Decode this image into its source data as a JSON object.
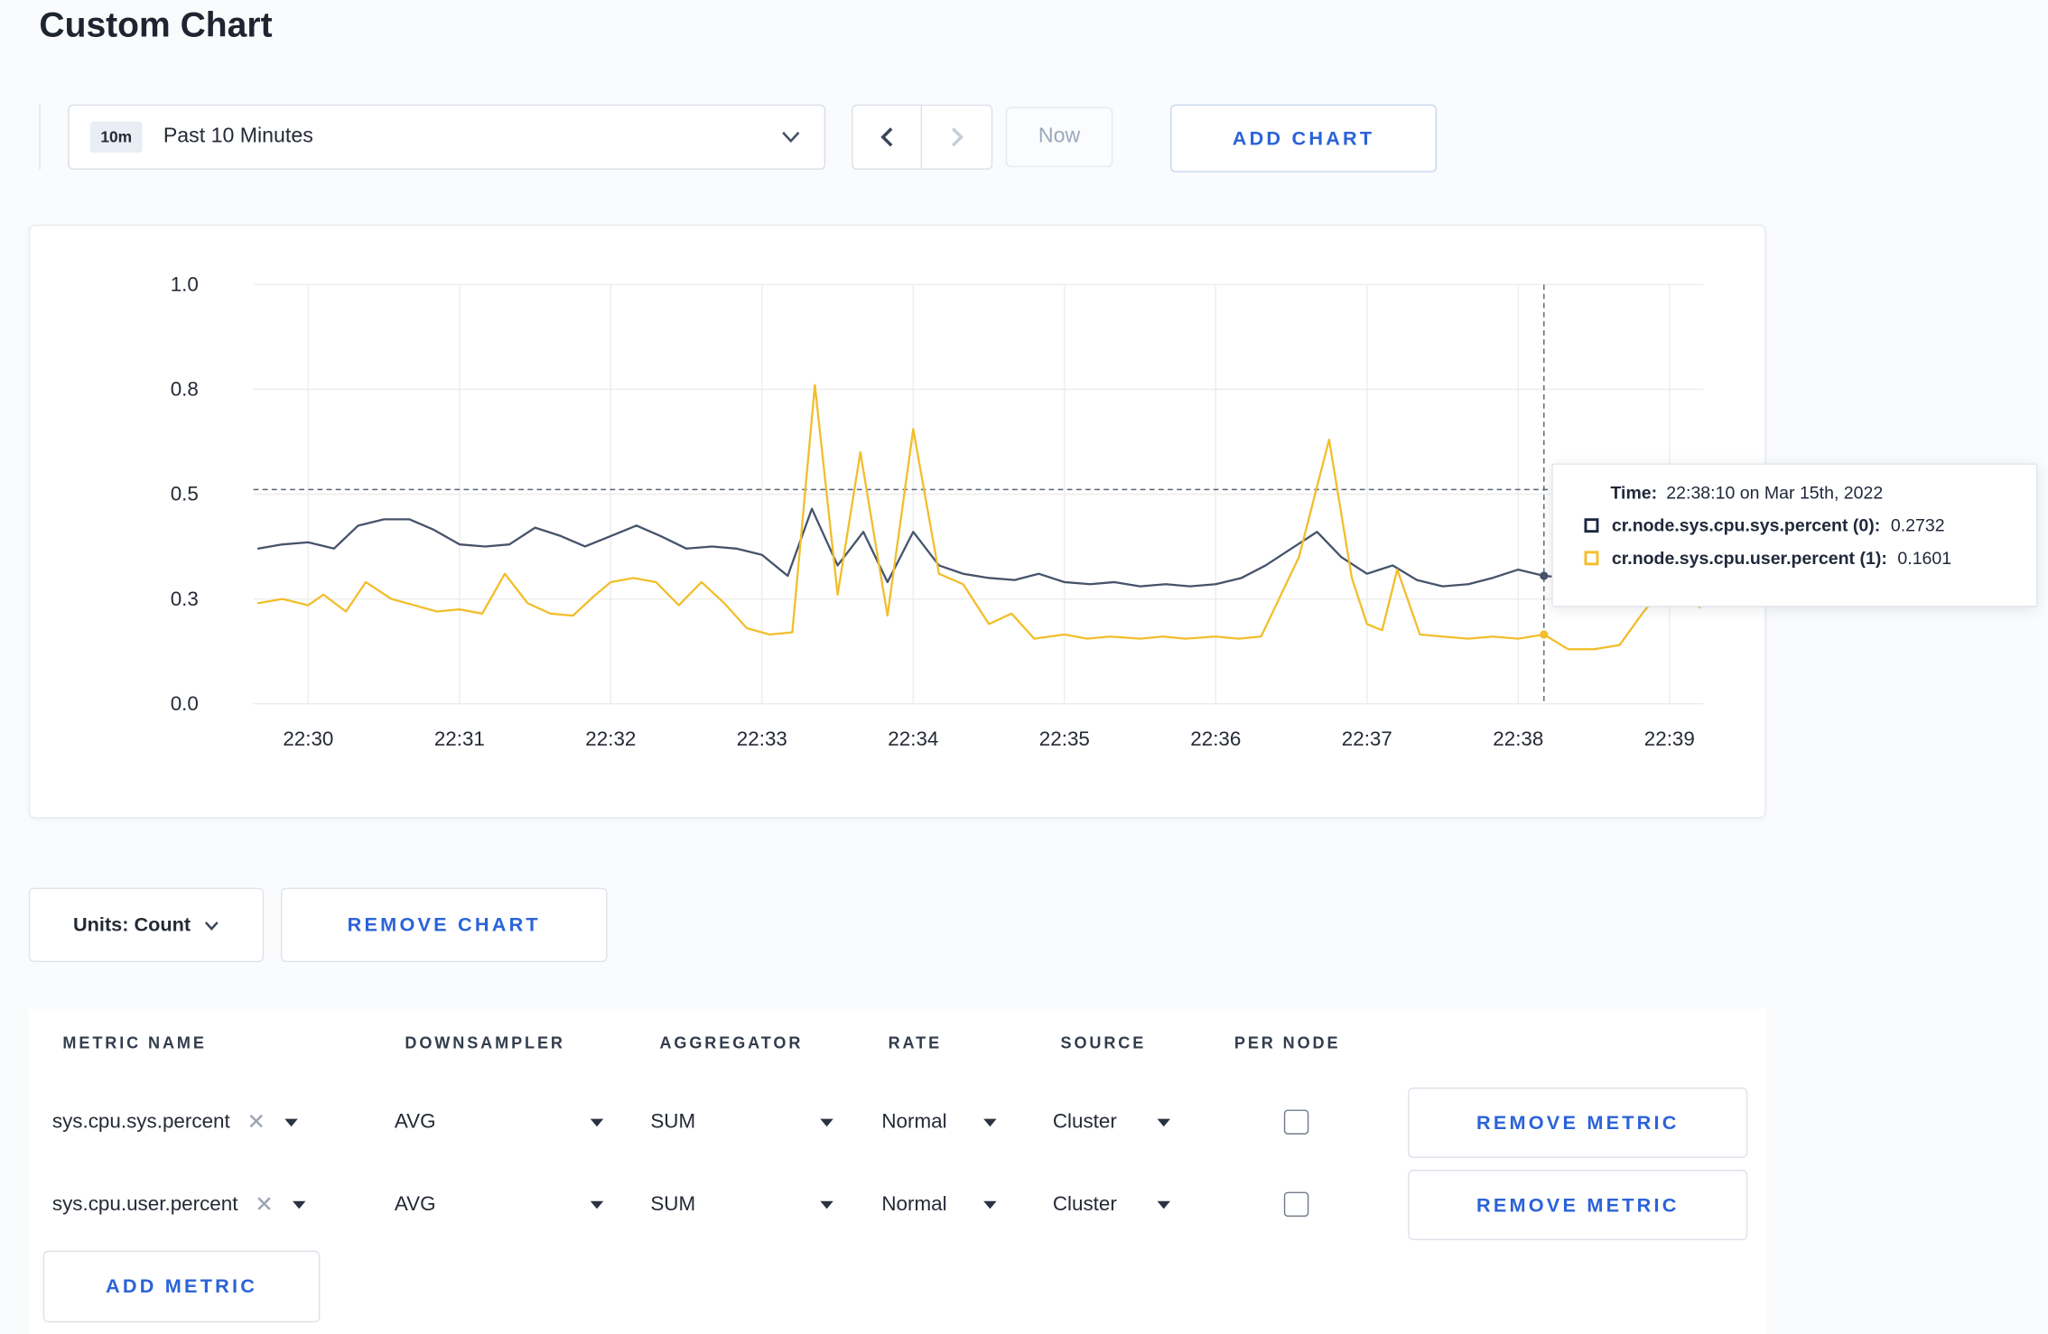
{
  "page": {
    "title": "Custom Chart"
  },
  "colors": {
    "accent_blue": "#2b63d8",
    "series_sys": "#46536b",
    "series_user": "#f2be2c",
    "grid": "#ededee",
    "crosshair": "#5b6573"
  },
  "icons": {
    "time_dropdown": "chevron-down",
    "prev": "chevron-left",
    "next": "chevron-right",
    "units_dropdown": "chevron-down",
    "select_caret": "caret-down",
    "metric_remove": "x-mark",
    "series_swatch": "square-outline"
  },
  "toolbar": {
    "time_range": {
      "badge": "10m",
      "label": "Past 10 Minutes"
    },
    "now_label": "Now",
    "add_chart_label": "ADD CHART"
  },
  "tooltip": {
    "time_label": "Time:",
    "time_value": "22:38:10 on Mar 15th, 2022",
    "rows": [
      {
        "label": "cr.node.sys.cpu.sys.percent (0):",
        "value": "0.2732",
        "color": "#1b2740"
      },
      {
        "label": "cr.node.sys.cpu.user.percent (1):",
        "value": "0.1601",
        "color": "#f2be2c"
      }
    ]
  },
  "units": {
    "button": "Units: Count",
    "remove_chart_label": "REMOVE CHART"
  },
  "metrics_table": {
    "headers": [
      "METRIC NAME",
      "DOWNSAMPLER",
      "AGGREGATOR",
      "RATE",
      "SOURCE",
      "PER NODE"
    ],
    "rows": [
      {
        "metric": "sys.cpu.sys.percent",
        "downsampler": "AVG",
        "aggregator": "SUM",
        "rate": "Normal",
        "source": "Cluster",
        "per_node": false,
        "remove_label": "REMOVE METRIC"
      },
      {
        "metric": "sys.cpu.user.percent",
        "downsampler": "AVG",
        "aggregator": "SUM",
        "rate": "Normal",
        "source": "Cluster",
        "per_node": false,
        "remove_label": "REMOVE METRIC"
      }
    ],
    "add_metric_label": "ADD METRIC"
  },
  "chart_data": {
    "type": "line",
    "title": "",
    "xlabel": "",
    "ylabel": "",
    "ylim": [
      0,
      1
    ],
    "x_domain_minutes_after_2230": [
      -0.33,
      9.22
    ],
    "grid": true,
    "x_ticks": [
      "22:30",
      "22:31",
      "22:32",
      "22:33",
      "22:34",
      "22:35",
      "22:36",
      "22:37",
      "22:38",
      "22:39"
    ],
    "y_ticks": [
      {
        "v": 0.0,
        "label": "0.0"
      },
      {
        "v": 0.25,
        "label": "0.3"
      },
      {
        "v": 0.5,
        "label": "0.5"
      },
      {
        "v": 0.75,
        "label": "0.8"
      },
      {
        "v": 1.0,
        "label": "1.0"
      }
    ],
    "crosshair": {
      "t": 8.17,
      "h_value": 0.511,
      "markers": [
        0.305,
        0.165
      ]
    },
    "series": [
      {
        "name": "cr.node.sys.cpu.sys.percent",
        "color": "#46536b",
        "points": [
          [
            -0.33,
            0.37
          ],
          [
            -0.17,
            0.38
          ],
          [
            0,
            0.385
          ],
          [
            0.17,
            0.37
          ],
          [
            0.33,
            0.425
          ],
          [
            0.5,
            0.44
          ],
          [
            0.67,
            0.44
          ],
          [
            0.83,
            0.415
          ],
          [
            1,
            0.38
          ],
          [
            1.17,
            0.375
          ],
          [
            1.33,
            0.38
          ],
          [
            1.5,
            0.42
          ],
          [
            1.67,
            0.4
          ],
          [
            1.83,
            0.375
          ],
          [
            2,
            0.4
          ],
          [
            2.17,
            0.425
          ],
          [
            2.33,
            0.4
          ],
          [
            2.5,
            0.37
          ],
          [
            2.67,
            0.375
          ],
          [
            2.83,
            0.37
          ],
          [
            3,
            0.355
          ],
          [
            3.17,
            0.305
          ],
          [
            3.33,
            0.465
          ],
          [
            3.5,
            0.33
          ],
          [
            3.67,
            0.41
          ],
          [
            3.83,
            0.29
          ],
          [
            4,
            0.41
          ],
          [
            4.17,
            0.33
          ],
          [
            4.33,
            0.31
          ],
          [
            4.5,
            0.3
          ],
          [
            4.67,
            0.295
          ],
          [
            4.83,
            0.31
          ],
          [
            5,
            0.29
          ],
          [
            5.17,
            0.285
          ],
          [
            5.33,
            0.29
          ],
          [
            5.5,
            0.28
          ],
          [
            5.67,
            0.285
          ],
          [
            5.83,
            0.28
          ],
          [
            6,
            0.285
          ],
          [
            6.17,
            0.3
          ],
          [
            6.33,
            0.33
          ],
          [
            6.5,
            0.37
          ],
          [
            6.67,
            0.41
          ],
          [
            6.83,
            0.35
          ],
          [
            7,
            0.31
          ],
          [
            7.17,
            0.33
          ],
          [
            7.33,
            0.295
          ],
          [
            7.5,
            0.28
          ],
          [
            7.67,
            0.285
          ],
          [
            7.83,
            0.3
          ],
          [
            8,
            0.32
          ],
          [
            8.17,
            0.305
          ],
          [
            8.33,
            0.3
          ],
          [
            8.5,
            0.31
          ],
          [
            8.67,
            0.3
          ],
          [
            8.83,
            0.3
          ],
          [
            9,
            0.305
          ],
          [
            9.2,
            0.27
          ]
        ]
      },
      {
        "name": "cr.node.sys.cpu.user.percent",
        "color": "#f2be2c",
        "points": [
          [
            -0.33,
            0.24
          ],
          [
            -0.17,
            0.25
          ],
          [
            0,
            0.235
          ],
          [
            0.1,
            0.26
          ],
          [
            0.25,
            0.22
          ],
          [
            0.38,
            0.29
          ],
          [
            0.55,
            0.25
          ],
          [
            0.7,
            0.235
          ],
          [
            0.85,
            0.22
          ],
          [
            1,
            0.225
          ],
          [
            1.15,
            0.215
          ],
          [
            1.3,
            0.31
          ],
          [
            1.45,
            0.24
          ],
          [
            1.6,
            0.215
          ],
          [
            1.75,
            0.21
          ],
          [
            1.9,
            0.26
          ],
          [
            2,
            0.29
          ],
          [
            2.15,
            0.3
          ],
          [
            2.3,
            0.29
          ],
          [
            2.45,
            0.235
          ],
          [
            2.6,
            0.29
          ],
          [
            2.75,
            0.24
          ],
          [
            2.9,
            0.18
          ],
          [
            3.05,
            0.165
          ],
          [
            3.2,
            0.17
          ],
          [
            3.35,
            0.76
          ],
          [
            3.5,
            0.26
          ],
          [
            3.65,
            0.6
          ],
          [
            3.83,
            0.21
          ],
          [
            4,
            0.655
          ],
          [
            4.17,
            0.31
          ],
          [
            4.33,
            0.285
          ],
          [
            4.5,
            0.19
          ],
          [
            4.65,
            0.215
          ],
          [
            4.8,
            0.155
          ],
          [
            5,
            0.165
          ],
          [
            5.15,
            0.155
          ],
          [
            5.3,
            0.16
          ],
          [
            5.5,
            0.155
          ],
          [
            5.65,
            0.16
          ],
          [
            5.8,
            0.155
          ],
          [
            6,
            0.16
          ],
          [
            6.15,
            0.155
          ],
          [
            6.3,
            0.16
          ],
          [
            6.55,
            0.35
          ],
          [
            6.75,
            0.63
          ],
          [
            6.9,
            0.3
          ],
          [
            7,
            0.19
          ],
          [
            7.1,
            0.175
          ],
          [
            7.2,
            0.32
          ],
          [
            7.35,
            0.165
          ],
          [
            7.5,
            0.16
          ],
          [
            7.67,
            0.155
          ],
          [
            7.83,
            0.16
          ],
          [
            8,
            0.155
          ],
          [
            8.17,
            0.165
          ],
          [
            8.33,
            0.13
          ],
          [
            8.5,
            0.13
          ],
          [
            8.67,
            0.14
          ],
          [
            8.83,
            0.22
          ],
          [
            9,
            0.29
          ],
          [
            9.2,
            0.23
          ]
        ]
      }
    ]
  }
}
